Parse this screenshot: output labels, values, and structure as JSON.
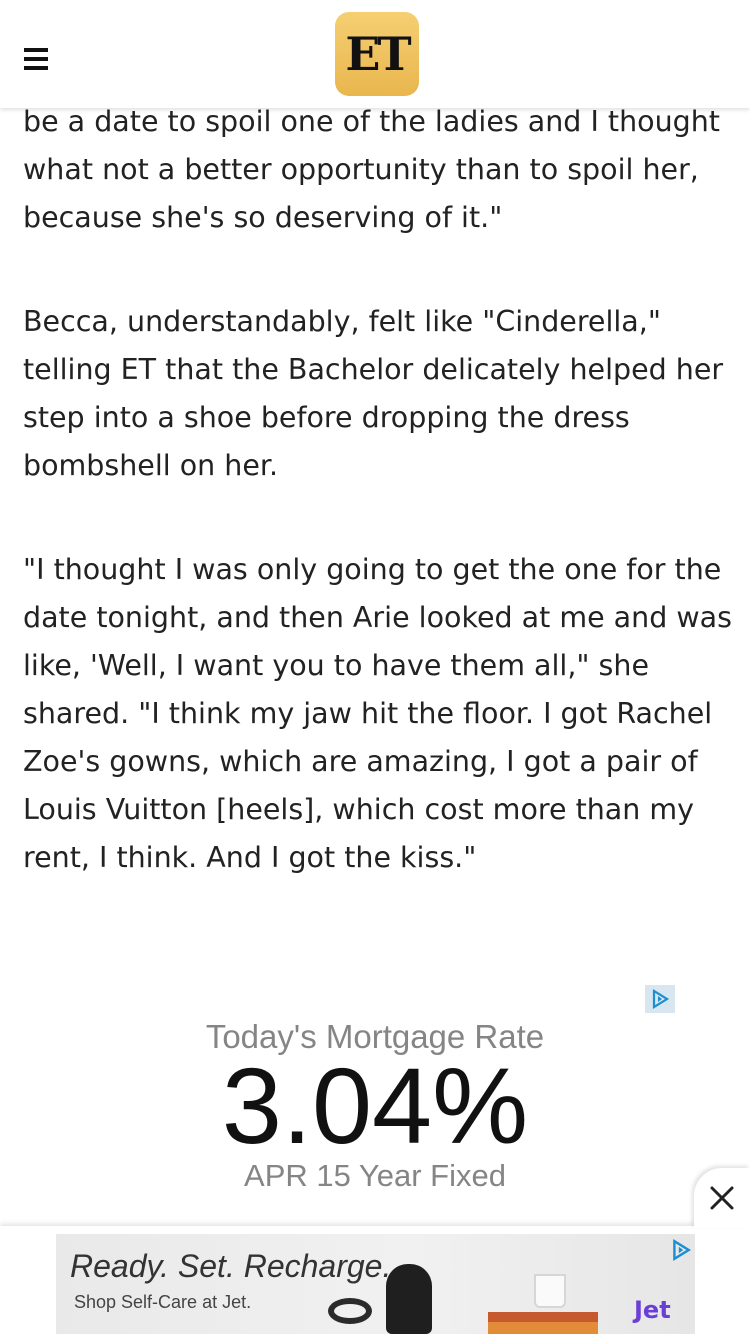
{
  "header": {
    "logo_text": "ET",
    "menu_icon": "hamburger-menu-icon"
  },
  "article": {
    "paragraphs": [
      "be a date to spoil one of the ladies and I thought what not a better opportunity than to spoil her, because she's so deserving of it.\"",
      "Becca, understandably, felt like \"Cinderella,\" telling ET that the Bachelor delicately helped her step into a shoe before dropping the dress bombshell on her.",
      "\"I thought I was only going to get the one for the date tonight, and then Arie looked at me and was like, 'Well, I want you to have them all,\" she shared. \"I think my jaw hit the floor. I got Rachel Zoe's gowns, which are amazing, I got a pair of Louis Vuitton [heels], which cost more than my rent, I think. And I got the kiss.\""
    ]
  },
  "ad_mortgage": {
    "title": "Today's Mortgage Rate",
    "rate": "3.04%",
    "subtitle": "APR 15 Year Fixed",
    "adchoices_icon": "adchoices-icon"
  },
  "bottom_banner": {
    "headline": "Ready. Set. Recharge.",
    "subline": "Shop Self-Care at Jet.",
    "brand": "Jet",
    "close_icon": "close-icon",
    "adchoices_icon": "adchoices-icon"
  },
  "colors": {
    "logo_gold": "#efc25f",
    "text": "#222222",
    "ad_gray": "#858585",
    "jet_purple": "#6b3fd6"
  }
}
